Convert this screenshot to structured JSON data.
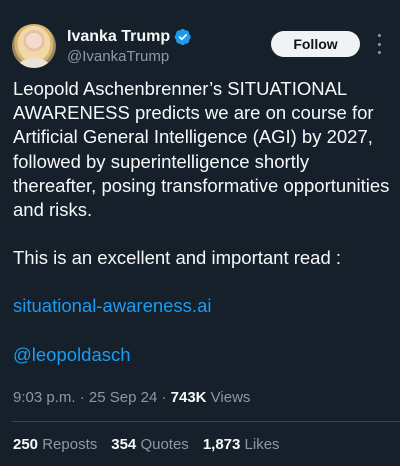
{
  "author": {
    "name": "Ivanka Trump",
    "handle": "@IvankaTrump",
    "verified": true,
    "verified_color": "#1d9bf0"
  },
  "follow_label": "Follow",
  "tweet": {
    "paragraph1": "Leopold Aschenbrenner’s SITUATIONAL AWARENESS predicts we are on course for Artificial General Intelligence (AGI) by 2027, followed by superintelligence shortly thereafter, posing transformative opportunities and risks.",
    "paragraph2": "This is an excellent and important read :",
    "link": "situational-awareness.ai",
    "mention": "@leopoldasch"
  },
  "meta": {
    "time": "9:03 p.m.",
    "sep1": "·",
    "date": "25 Sep 24",
    "sep2": "·",
    "views_count": "743K",
    "views_label": "Views"
  },
  "stats": {
    "reposts_count": "250",
    "reposts_label": "Reposts",
    "quotes_count": "354",
    "quotes_label": "Quotes",
    "likes_count": "1,873",
    "likes_label": "Likes"
  },
  "colors": {
    "background": "#15202b",
    "text": "#f7f9f9",
    "secondary": "#8b98a5",
    "link": "#1d9bf0"
  }
}
